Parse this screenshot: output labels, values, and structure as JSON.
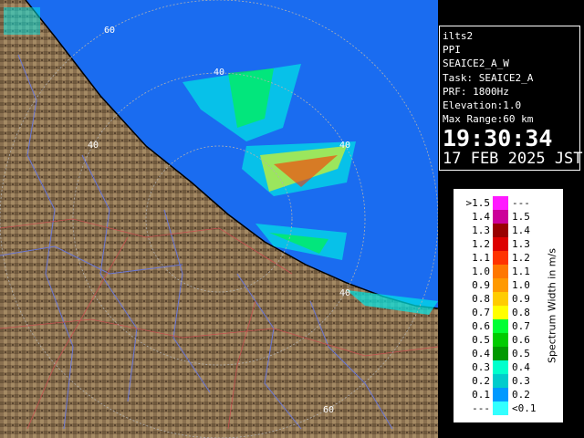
{
  "info_panel": {
    "lines": [
      "ilts2",
      "PPI",
      "SEAICE2_A_W",
      "Task: SEAICE2_A",
      "PRF: 1800Hz",
      "Elevation:1.0",
      "Max Range:60 km"
    ],
    "time": "19:30:34",
    "date": "17 FEB 2025 JST"
  },
  "legend": {
    "title": "Spectrum Width in m/s",
    "rows": [
      {
        "low": ">1.5",
        "high": "---",
        "color": "#ff1aff"
      },
      {
        "low": "1.4",
        "high": "1.5",
        "color": "#cc0099"
      },
      {
        "low": "1.3",
        "high": "1.4",
        "color": "#990000"
      },
      {
        "low": "1.2",
        "high": "1.3",
        "color": "#dd0000"
      },
      {
        "low": "1.1",
        "high": "1.2",
        "color": "#ff3300"
      },
      {
        "low": "1.0",
        "high": "1.1",
        "color": "#ff7700"
      },
      {
        "low": "0.9",
        "high": "1.0",
        "color": "#ff9900"
      },
      {
        "low": "0.8",
        "high": "0.9",
        "color": "#ffcc00"
      },
      {
        "low": "0.7",
        "high": "0.8",
        "color": "#ffff00"
      },
      {
        "low": "0.6",
        "high": "0.7",
        "color": "#00ff33"
      },
      {
        "low": "0.5",
        "high": "0.6",
        "color": "#00cc00"
      },
      {
        "low": "0.4",
        "high": "0.5",
        "color": "#009900"
      },
      {
        "low": "0.3",
        "high": "0.4",
        "color": "#00ffcc"
      },
      {
        "low": "0.2",
        "high": "0.3",
        "color": "#00cccc"
      },
      {
        "low": "0.1",
        "high": "0.2",
        "color": "#0099ff"
      },
      {
        "low": "---",
        "high": "<0.1",
        "color": "#33ffff"
      }
    ]
  },
  "map": {
    "sea_color": "#1a6cf0",
    "land_color": "#8a7050",
    "range_labels": [
      "60",
      "40",
      "40",
      "40",
      "40",
      "60"
    ]
  }
}
